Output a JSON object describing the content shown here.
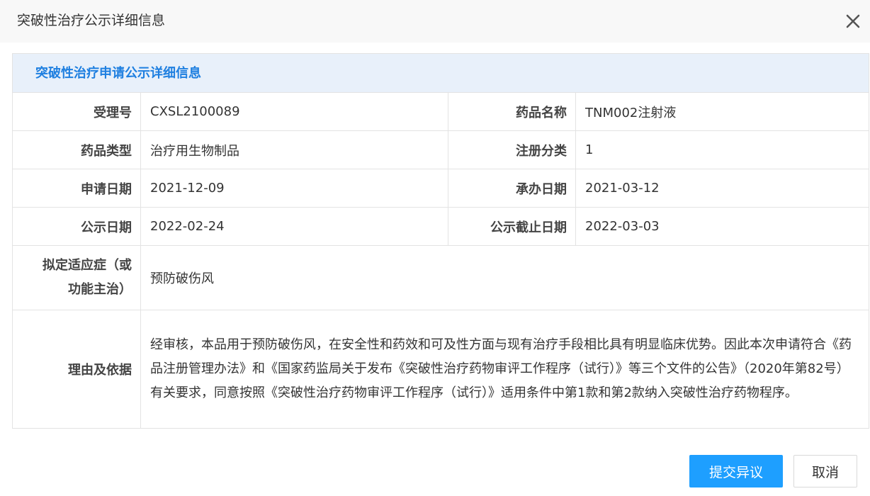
{
  "dialog": {
    "title": "突破性治疗公示详细信息",
    "close_icon": "close-icon"
  },
  "section": {
    "title": "突破性治疗申请公示详细信息"
  },
  "fields": {
    "acceptance_no": {
      "label": "受理号",
      "value": "CXSL2100089"
    },
    "drug_name": {
      "label": "药品名称",
      "value": "TNM002注射液"
    },
    "drug_type": {
      "label": "药品类型",
      "value": "治疗用生物制品"
    },
    "registration_class": {
      "label": "注册分类",
      "value": "1"
    },
    "application_date": {
      "label": "申请日期",
      "value": "2021-12-09"
    },
    "handling_date": {
      "label": "承办日期",
      "value": "2021-03-12"
    },
    "publicity_date": {
      "label": "公示日期",
      "value": "2022-02-24"
    },
    "publicity_deadline": {
      "label": "公示截止日期",
      "value": "2022-03-03"
    },
    "indication": {
      "label_line1": "拟定适应症（或",
      "label_line2": "功能主治）",
      "value": "预防破伤风"
    },
    "reason": {
      "label": "理由及依据",
      "value": "经审核，本品用于预防破伤风，在安全性和药效和可及性方面与现有治疗手段相比具有明显临床优势。因此本次申请符合《药品注册管理办法》和《国家药监局关于发布《突破性治疗药物审评工作程序（试行）》等三个文件的公告》（2020年第82号）有关要求，同意按照《突破性治疗药物审评工作程序（试行）》适用条件中第1款和第2款纳入突破性治疗药物程序。"
    }
  },
  "buttons": {
    "submit_objection": "提交异议",
    "cancel": "取消"
  },
  "colors": {
    "primary": "#1e9fff",
    "section_title": "#1e7fe0",
    "section_bg": "#e8f0fa",
    "header_bg": "#f8f8f8"
  }
}
